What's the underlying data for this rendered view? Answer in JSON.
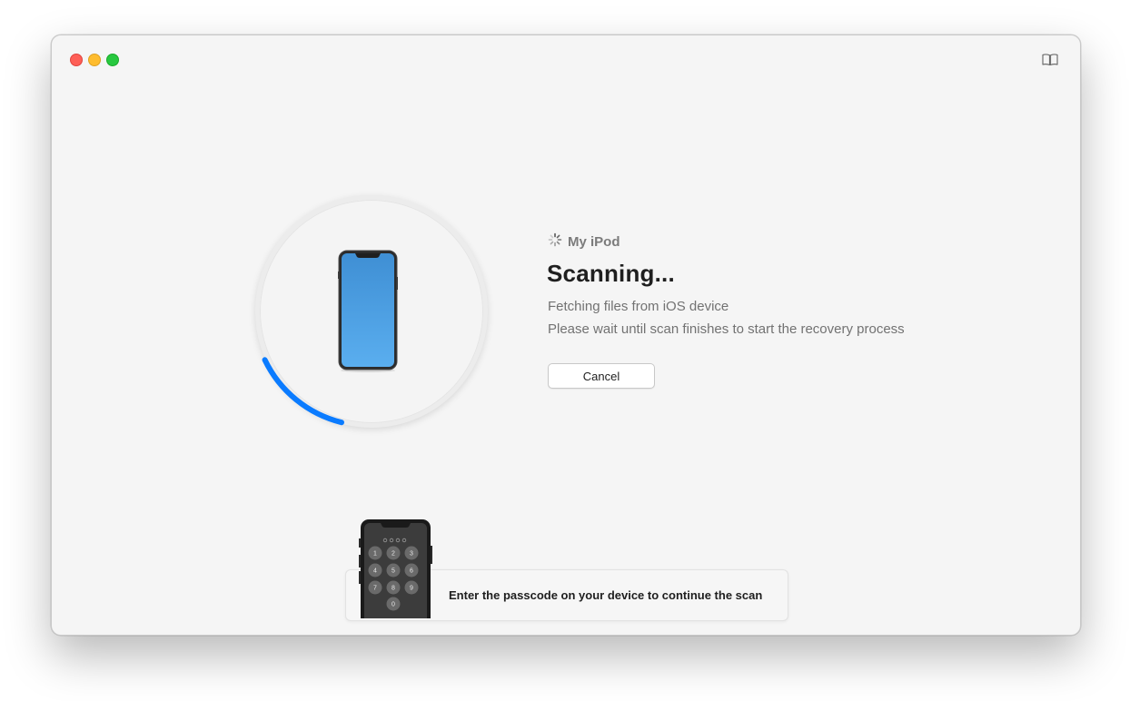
{
  "window": {
    "traffic_lights": [
      "close",
      "minimize",
      "zoom"
    ],
    "help_icon": "book-icon"
  },
  "device": {
    "name": "My iPod",
    "status_icon": "spinner-icon",
    "scan_progress_percent": 14,
    "accent_color": "#0a7bff",
    "screen_color": "#4a9ee0"
  },
  "scan": {
    "title": "Scanning...",
    "line1": "Fetching files from iOS device",
    "line2": "Please wait until scan finishes to start the recovery process",
    "cancel_label": "Cancel"
  },
  "passcode_banner": {
    "text": "Enter the passcode on your device to continue the scan",
    "keypad": [
      "1",
      "2",
      "3",
      "4",
      "5",
      "6",
      "7",
      "8",
      "9",
      "0"
    ]
  }
}
